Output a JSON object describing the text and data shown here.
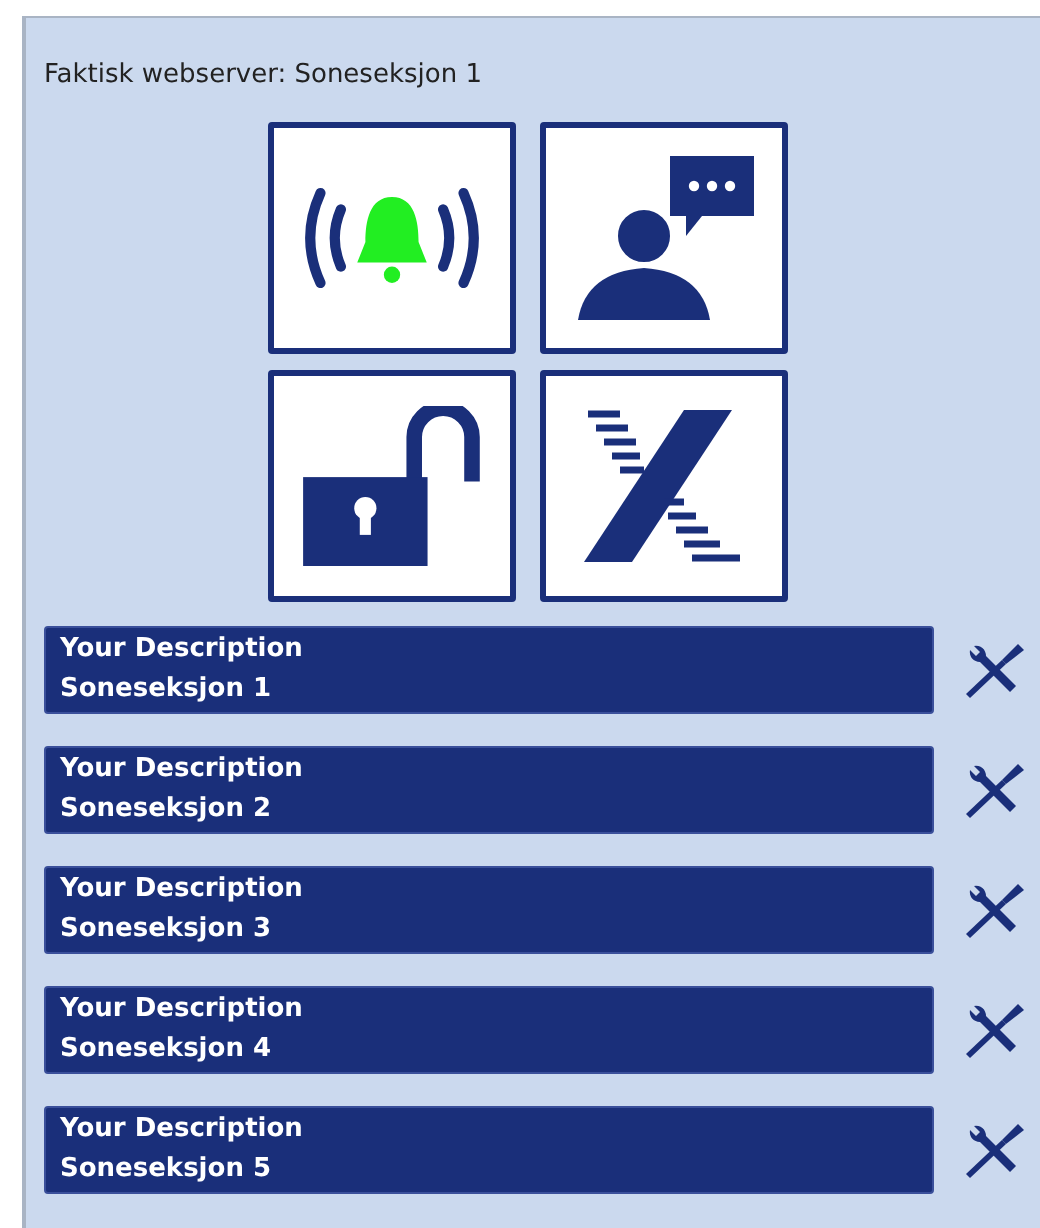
{
  "header": {
    "title": "Faktisk webserver: Soneseksjon 1"
  },
  "tiles": [
    {
      "kind": "alarm"
    },
    {
      "kind": "chat"
    },
    {
      "kind": "lock"
    },
    {
      "kind": "logo"
    }
  ],
  "sections": [
    {
      "description": "Your Description",
      "name": "Soneseksjon 1"
    },
    {
      "description": "Your Description",
      "name": "Soneseksjon 2"
    },
    {
      "description": "Your Description",
      "name": "Soneseksjon 3"
    },
    {
      "description": "Your Description",
      "name": "Soneseksjon 4"
    },
    {
      "description": "Your Description",
      "name": "Soneseksjon 5"
    }
  ]
}
